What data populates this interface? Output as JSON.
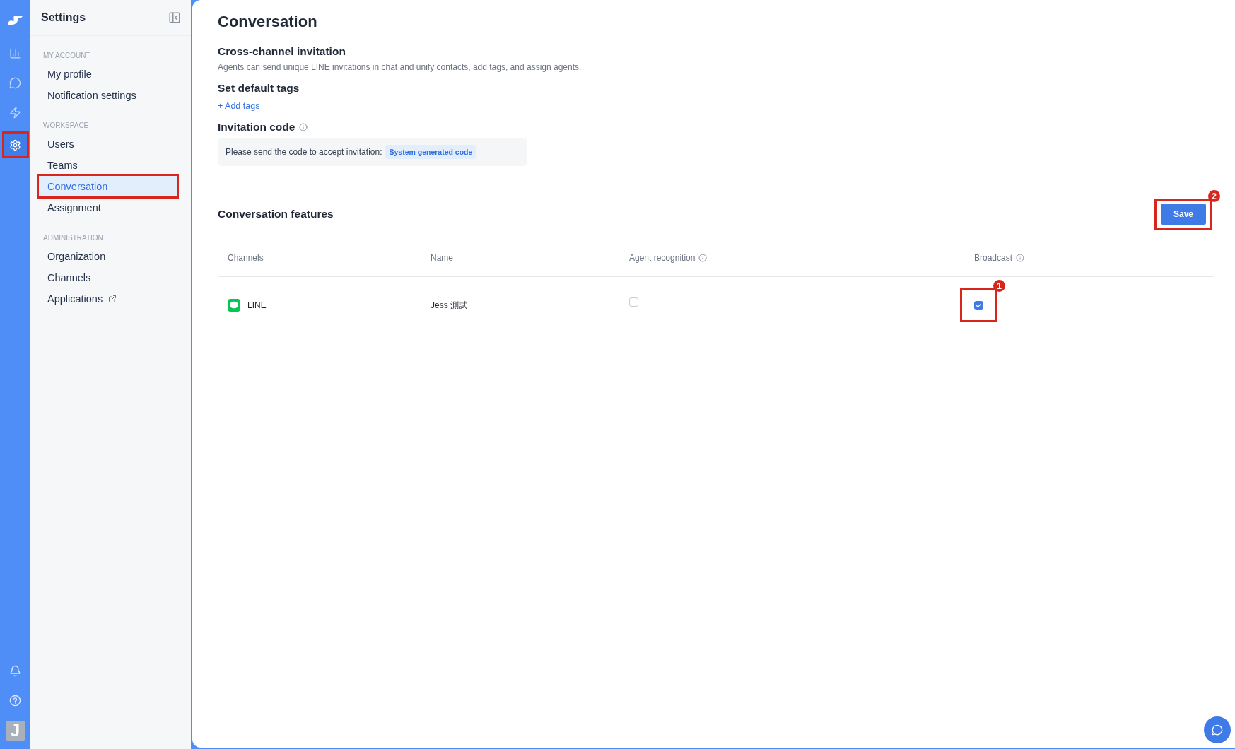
{
  "rail": {
    "items": [
      {
        "kind": "reports",
        "selected": false,
        "highlighted": false
      },
      {
        "kind": "chat",
        "selected": false,
        "highlighted": false
      },
      {
        "kind": "automation",
        "selected": false,
        "highlighted": false
      },
      {
        "kind": "settings",
        "selected": true,
        "highlighted": true
      }
    ],
    "bottom": [
      {
        "kind": "bell"
      },
      {
        "kind": "help"
      }
    ],
    "avatar": "J"
  },
  "sidebar": {
    "title": "Settings",
    "sections": [
      {
        "label": "MY ACCOUNT",
        "items": [
          {
            "label": "My profile",
            "selected": false,
            "highlighted": false,
            "external": false
          },
          {
            "label": "Notification settings",
            "selected": false,
            "highlighted": false,
            "external": false
          }
        ]
      },
      {
        "label": "WORKSPACE",
        "items": [
          {
            "label": "Users",
            "selected": false,
            "highlighted": false,
            "external": false
          },
          {
            "label": "Teams",
            "selected": false,
            "highlighted": false,
            "external": false
          },
          {
            "label": "Conversation",
            "selected": true,
            "highlighted": true,
            "external": false
          },
          {
            "label": "Assignment",
            "selected": false,
            "highlighted": false,
            "external": false
          }
        ]
      },
      {
        "label": "ADMINISTRATION",
        "items": [
          {
            "label": "Organization",
            "selected": false,
            "highlighted": false,
            "external": false
          },
          {
            "label": "Channels",
            "selected": false,
            "highlighted": false,
            "external": false
          },
          {
            "label": "Applications",
            "selected": false,
            "highlighted": false,
            "external": true
          }
        ]
      }
    ]
  },
  "page": {
    "title": "Conversation",
    "invitation": {
      "title": "Cross-channel invitation",
      "description": "Agents can send unique LINE invitations in chat and unify contacts, add tags, and assign agents.",
      "tags_title": "Set default tags",
      "add_tags": "+ Add tags",
      "code_title": "Invitation code",
      "code_text": "Please send the code to accept invitation:",
      "code_badge": "System generated code"
    },
    "features": {
      "title": "Conversation features",
      "save": {
        "label": "Save",
        "highlighted": true,
        "annotation": "2"
      },
      "columns": [
        {
          "label": "Channels",
          "info": false
        },
        {
          "label": "Name",
          "info": false
        },
        {
          "label": "Agent recognition",
          "info": true
        },
        {
          "label": "Broadcast",
          "info": true
        }
      ],
      "rows": [
        {
          "channel": "LINE",
          "name": "Jess 測試",
          "agent_recognition": {
            "checked": false,
            "highlighted": false
          },
          "broadcast": {
            "checked": true,
            "highlighted": true,
            "annotation": "1"
          }
        }
      ]
    }
  }
}
